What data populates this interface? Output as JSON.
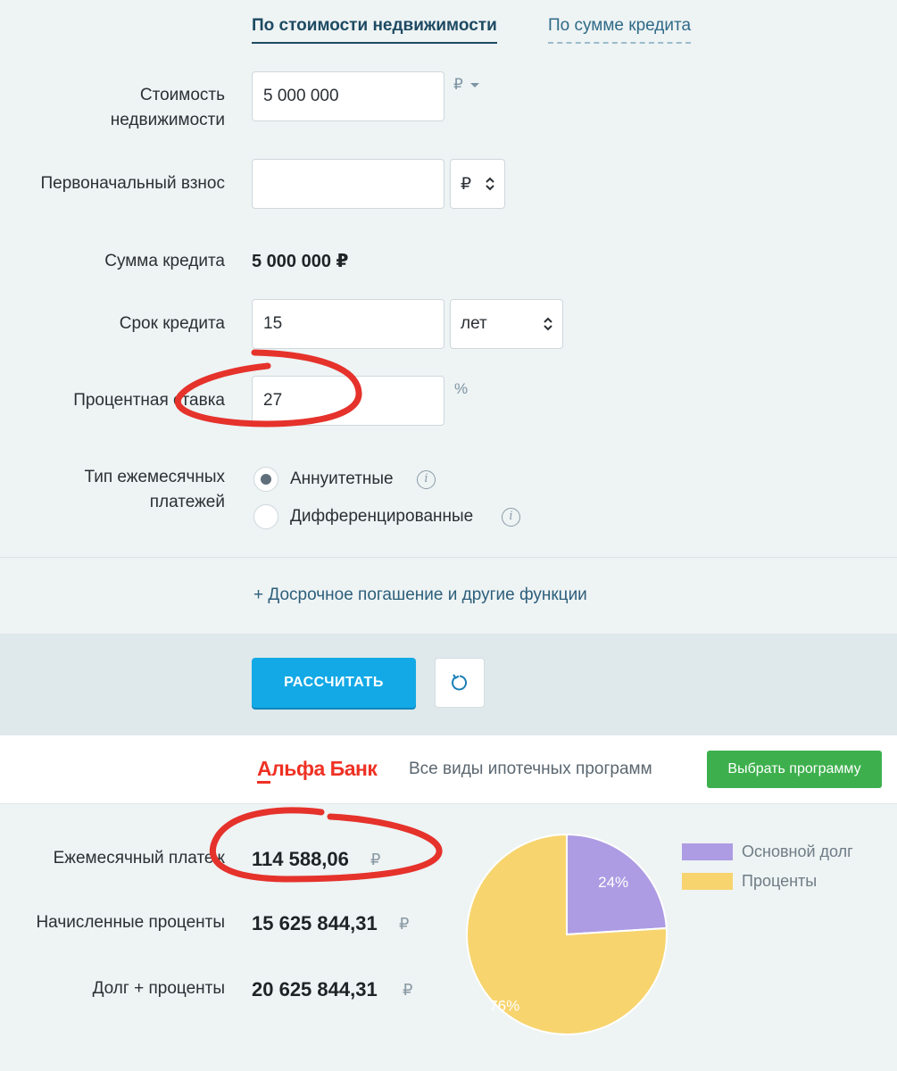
{
  "tabs": {
    "by_property_cost": "По стоимости недвижимости",
    "by_loan_amount": "По сумме кредита"
  },
  "form": {
    "property_cost": {
      "label_line1": "Стоимость",
      "label_line2": "недвижимости",
      "value": "5 000 000",
      "currency": "₽"
    },
    "down_payment": {
      "label": "Первоначальный взнос",
      "value": "",
      "unit": "₽"
    },
    "loan_amount": {
      "label": "Сумма кредита",
      "value": "5 000 000 ₽"
    },
    "loan_term": {
      "label": "Срок кредита",
      "value": "15",
      "unit": "лет"
    },
    "interest_rate": {
      "label": "Процентная ставка",
      "value": "27",
      "unit": "%"
    },
    "payment_type": {
      "label_line1": "Тип ежемесячных",
      "label_line2": "платежей",
      "options": [
        {
          "label": "Аннуитетные",
          "checked": true
        },
        {
          "label": "Дифференцированные",
          "checked": false
        }
      ]
    },
    "more_functions": "+ Досрочное погашение и другие функции",
    "calculate_button": "РАССЧИТАТЬ"
  },
  "ad": {
    "brand": "Альфа Банк",
    "text": "Все виды ипотечных программ",
    "button": "Выбрать программу",
    "brand_color": "#ef3124"
  },
  "results": {
    "monthly_payment": {
      "label": "Ежемесячный платеж",
      "value": "114 588,06",
      "currency": "₽"
    },
    "accrued_interest": {
      "label": "Начисленные проценты",
      "value": "15 625 844,31",
      "currency": "₽"
    },
    "total": {
      "label": "Долг + проценты",
      "value": "20 625 844,31",
      "currency": "₽"
    }
  },
  "chart_data": {
    "type": "pie",
    "series": [
      {
        "name": "Основной долг",
        "value": 24,
        "label": "24%",
        "color": "#ad9ce3"
      },
      {
        "name": "Проценты",
        "value": 76,
        "label": "76%",
        "color": "#f7d46e"
      }
    ],
    "legend_position": "right"
  },
  "annotations": {
    "ink_color": "#e5322b"
  }
}
